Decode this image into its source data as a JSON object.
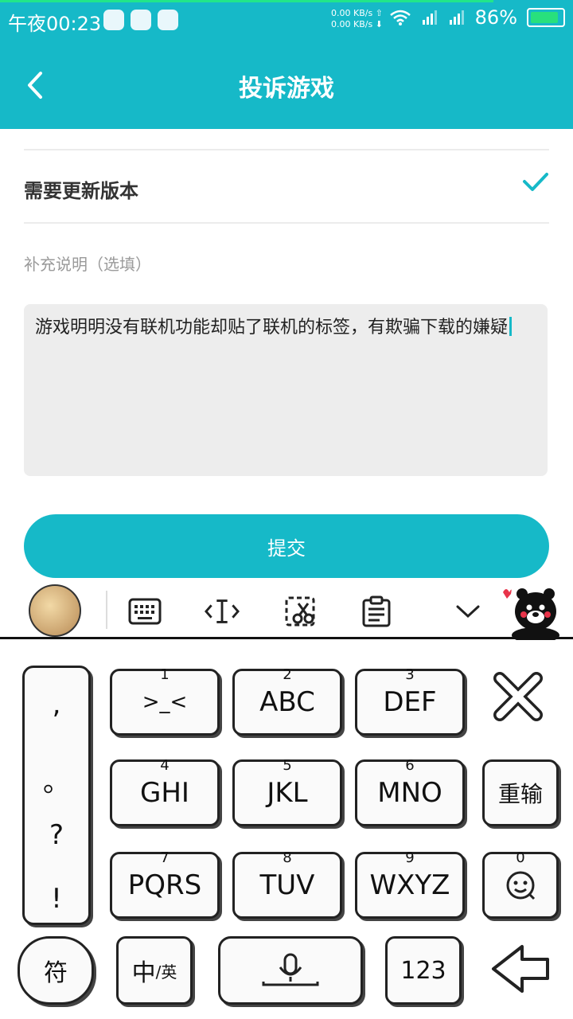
{
  "status_bar": {
    "time": "午夜00:23",
    "net_up": "0.00 KB/s ⇧",
    "net_down": "0.00 KB/s ⬇",
    "battery": "86%"
  },
  "header": {
    "title": "投诉游戏"
  },
  "form": {
    "selected_option": "需要更新版本",
    "note_label": "补充说明（选填）",
    "note_text": "游戏明明没有联机功能却贴了联机的标签，有欺骗下载的嫌疑",
    "submit_label": "提交"
  },
  "keyboard": {
    "punctuation": [
      ",",
      "。",
      "?",
      "!"
    ],
    "keys": [
      {
        "num": "1",
        "label": ">_<"
      },
      {
        "num": "2",
        "label": "ABC"
      },
      {
        "num": "3",
        "label": "DEF"
      },
      {
        "num": "4",
        "label": "GHI"
      },
      {
        "num": "5",
        "label": "JKL"
      },
      {
        "num": "6",
        "label": "MNO"
      },
      {
        "num": "7",
        "label": "PQRS"
      },
      {
        "num": "8",
        "label": "TUV"
      },
      {
        "num": "9",
        "label": "WXYZ"
      },
      {
        "num": "0",
        "label": ""
      }
    ],
    "retype_label": "重输",
    "symbol_label": "符",
    "lang_main": "中",
    "lang_sub": "/英",
    "num_label": "123"
  },
  "colors": {
    "accent": "#16b9c8",
    "text_dark": "#333333",
    "hint": "#9a9a9a"
  }
}
